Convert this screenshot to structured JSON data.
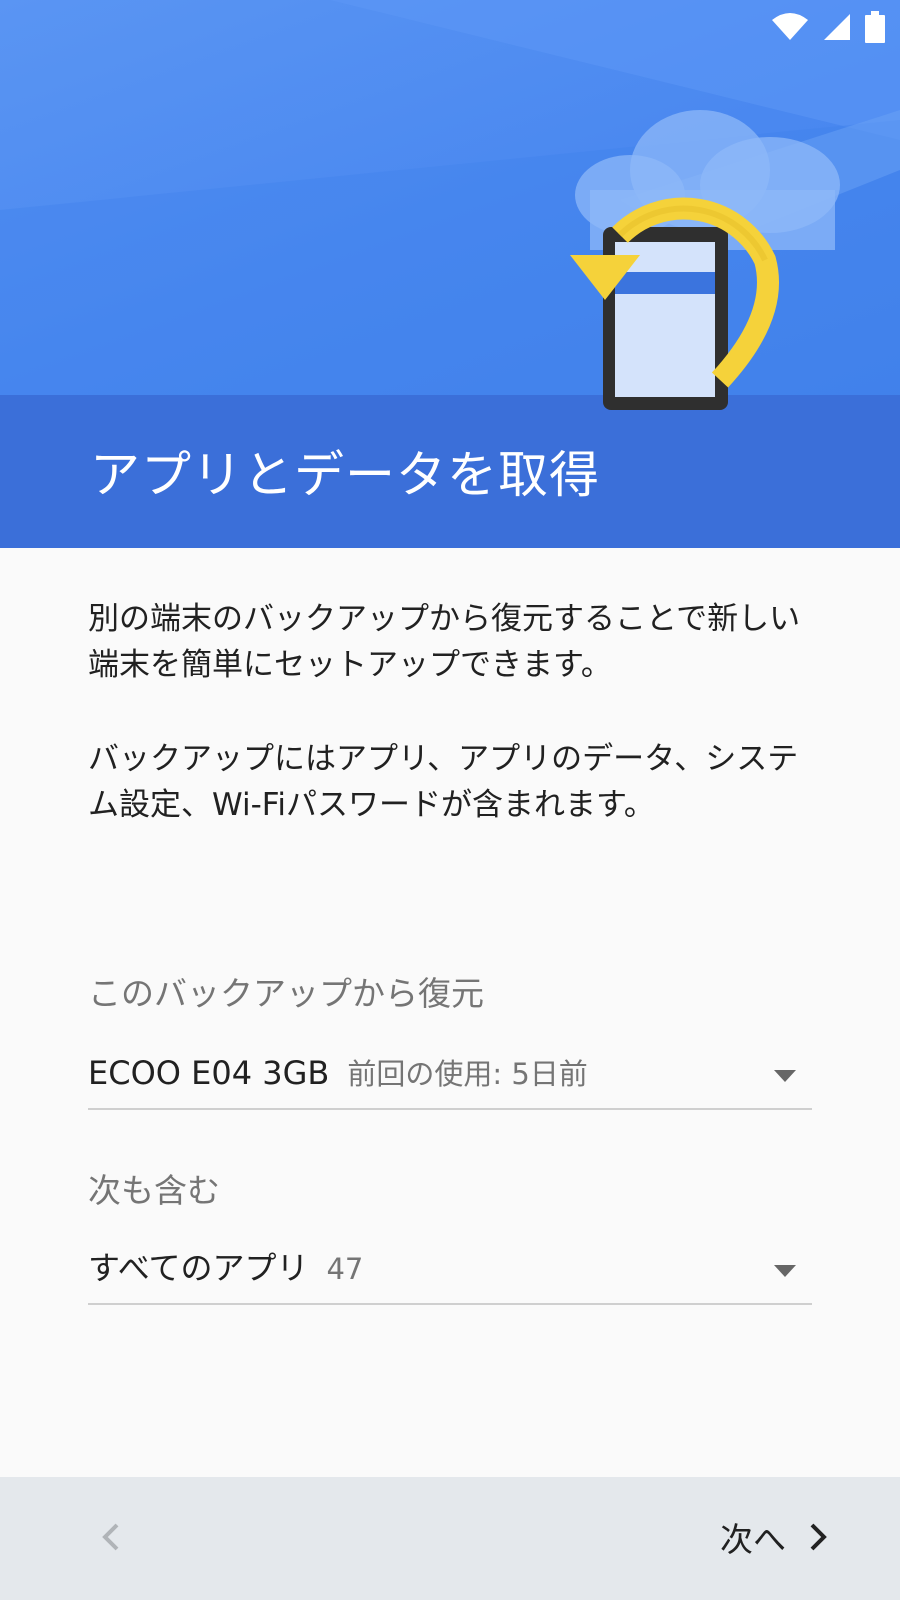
{
  "colors": {
    "header_blue": "#4a88f0",
    "band_blue": "#3b6fd9",
    "arrow_yellow": "#f5d23a",
    "footer_gray": "#e4e8ec"
  },
  "status_bar": {
    "icons": [
      "wifi-icon",
      "signal-icon",
      "battery-icon"
    ]
  },
  "header": {
    "title": "アプリとデータを取得",
    "illustration": "phone-restore-illustration"
  },
  "main": {
    "paragraphs": [
      "別の端末のバックアップから復元することで新しい端末を簡単にセットアップできます。",
      "バックアップにはアプリ、アプリのデータ、システム設定、Wi-Fiパスワードが含まれます。"
    ],
    "restore": {
      "label": "このバックアップから復元",
      "device": "ECOO E04 3GB",
      "last_used": "前回の使用: 5日前"
    },
    "include": {
      "label": "次も含む",
      "value": "すべてのアプリ",
      "count": "47"
    }
  },
  "footer": {
    "back_icon": "chevron-left-icon",
    "next_label": "次へ",
    "next_icon": "chevron-right-icon"
  }
}
